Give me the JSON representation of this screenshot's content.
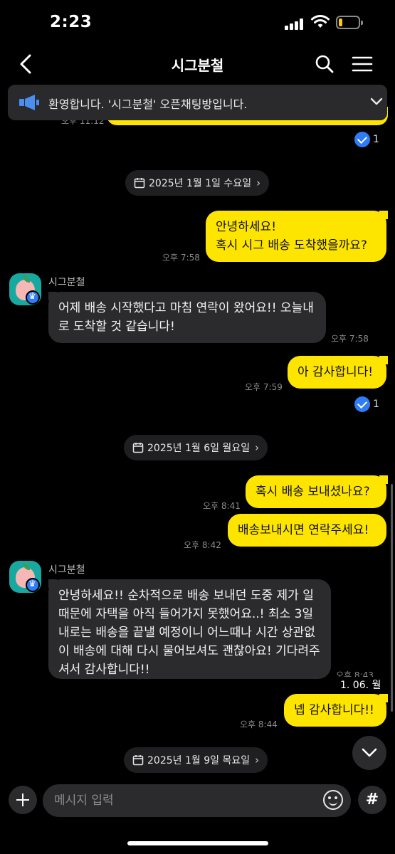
{
  "status": {
    "time": "2:23"
  },
  "header": {
    "title": "시그분철"
  },
  "notice": {
    "text": "환영합니다. '시그분철' 오픈채팅방입니다."
  },
  "partial": {
    "time": "오후 11:12",
    "read_count": "1"
  },
  "dates": [
    "2025년 1월 1일 수요일",
    "2025년 1월 6일 월요일",
    "2025년 1월 9일 목요일"
  ],
  "messages": [
    {
      "from": "me",
      "text": "안녕하세요!\n혹시 시그 배송 도착했을까요?",
      "time": "오후 7:58"
    },
    {
      "from": "other",
      "sender": "시그분철",
      "text": "어제 배송 시작했다고 마침 연락이 왔어요!! 오늘내로 도착할 것 같습니다!",
      "time": "오후 7:58"
    },
    {
      "from": "me",
      "text": "아 감사합니다!",
      "time": "오후 7:59",
      "read_count": "1"
    },
    {
      "from": "me",
      "text": "혹시 배송 보내셨나요?",
      "time": "오후 8:41"
    },
    {
      "from": "me",
      "text": "배송보내시면 연락주세요!",
      "time": "오후 8:42"
    },
    {
      "from": "other",
      "sender": "시그분철",
      "text": "안녕하세요!! 순차적으로 배송 보내던 도중 제가 일 때문에 자택을 아직 들어가지 못했어요..! 최소 3일내로는 배송을 끝낼 예정이니 어느때나 시간 상관없이 배송에 대해 다시 물어보셔도 괜찮아요! 기다려주셔서 감사합니다!!",
      "time": "오후 8:43"
    },
    {
      "from": "me",
      "text": "넵 감사합니다!!",
      "time": "오후 8:44"
    }
  ],
  "overlay_date": "1. 06. 월",
  "input": {
    "placeholder": "메시지 입력"
  },
  "colors": {
    "my_bubble": "#fee500",
    "other_bubble": "#2b2b2d",
    "read_badge": "#2f7cf6",
    "avatar_bg": "#17a9a0"
  }
}
